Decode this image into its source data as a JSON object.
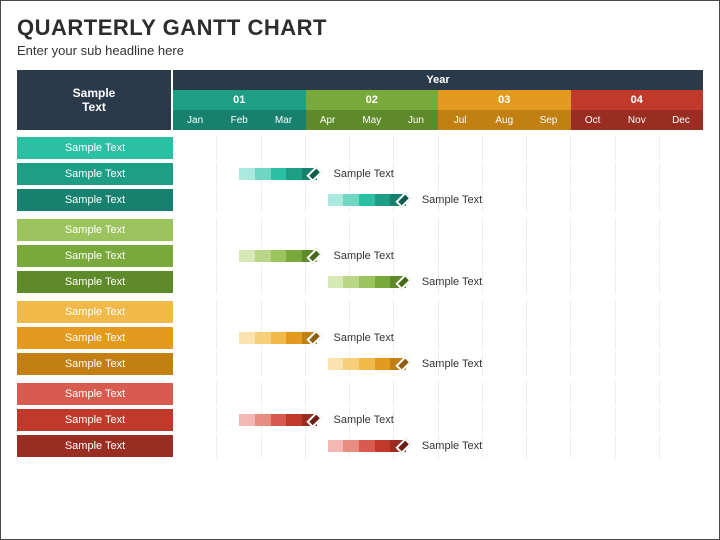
{
  "title": "QUARTERLY GANTT CHART",
  "subtitle": "Enter your sub headline here",
  "corner": "Sample\nText",
  "header": {
    "year_label": "Year",
    "quarters": [
      {
        "label": "01",
        "color": "#1f9e86",
        "months_bg": "#17816d"
      },
      {
        "label": "02",
        "color": "#7aa93b",
        "months_bg": "#5f8a2a"
      },
      {
        "label": "03",
        "color": "#e39a1f",
        "months_bg": "#c27f12"
      },
      {
        "label": "04",
        "color": "#c0392b",
        "months_bg": "#992d22"
      }
    ],
    "months": [
      "Jan",
      "Feb",
      "Mar",
      "Apr",
      "May",
      "Jun",
      "Jul",
      "Aug",
      "Sep",
      "Oct",
      "Nov",
      "Dec"
    ]
  },
  "chart_data": {
    "type": "gantt",
    "title": "Quarterly Gantt Chart",
    "x_categories_months": [
      "Jan",
      "Feb",
      "Mar",
      "Apr",
      "May",
      "Jun",
      "Jul",
      "Aug",
      "Sep",
      "Oct",
      "Nov",
      "Dec"
    ],
    "groups": [
      {
        "color_family": "teal",
        "label_colors": [
          "#2bbfa3",
          "#1f9e86",
          "#17816d"
        ],
        "row_labels": [
          "Sample Text",
          "Sample Text",
          "Sample Text"
        ],
        "bars": [
          {
            "start_month": 1.5,
            "end_month": 5.0,
            "annotation": "Sample Text",
            "segments": [
              "#a9e9de",
              "#6fd6c4",
              "#2bbfa3",
              "#1f9e86",
              "#17816d"
            ],
            "diamond": "#0e5a4c"
          },
          {
            "start_month": 3.5,
            "end_month": 7.0,
            "annotation": "Sample Text",
            "segments": [
              "#a9e9de",
              "#6fd6c4",
              "#2bbfa3",
              "#1f9e86",
              "#17816d"
            ],
            "diamond": "#0e5a4c"
          }
        ]
      },
      {
        "color_family": "green",
        "label_colors": [
          "#9bc45f",
          "#7aa93b",
          "#5f8a2a"
        ],
        "row_labels": [
          "Sample Text",
          "Sample Text",
          "Sample Text"
        ],
        "bars": [
          {
            "start_month": 1.5,
            "end_month": 5.0,
            "annotation": "Sample Text",
            "segments": [
              "#d6e8b5",
              "#b9d786",
              "#9bc45f",
              "#7aa93b",
              "#5f8a2a"
            ],
            "diamond": "#476b1d"
          },
          {
            "start_month": 3.5,
            "end_month": 7.0,
            "annotation": "Sample Text",
            "segments": [
              "#d6e8b5",
              "#b9d786",
              "#9bc45f",
              "#7aa93b",
              "#5f8a2a"
            ],
            "diamond": "#476b1d"
          }
        ]
      },
      {
        "color_family": "orange",
        "label_colors": [
          "#f1b94a",
          "#e39a1f",
          "#c27f12"
        ],
        "row_labels": [
          "Sample Text",
          "Sample Text",
          "Sample Text"
        ],
        "bars": [
          {
            "start_month": 1.5,
            "end_month": 5.0,
            "annotation": "Sample Text",
            "segments": [
              "#fbe3b0",
              "#f6cf7a",
              "#f1b94a",
              "#e39a1f",
              "#c27f12"
            ],
            "diamond": "#8f5d0b"
          },
          {
            "start_month": 3.5,
            "end_month": 7.0,
            "annotation": "Sample Text",
            "segments": [
              "#fbe3b0",
              "#f6cf7a",
              "#f1b94a",
              "#e39a1f",
              "#c27f12"
            ],
            "diamond": "#8f5d0b"
          }
        ]
      },
      {
        "color_family": "red",
        "label_colors": [
          "#d75b4e",
          "#c0392b",
          "#992d22"
        ],
        "row_labels": [
          "Sample Text",
          "Sample Text",
          "Sample Text"
        ],
        "bars": [
          {
            "start_month": 1.5,
            "end_month": 5.0,
            "annotation": "Sample Text",
            "segments": [
              "#f2b8b1",
              "#e88d82",
              "#d75b4e",
              "#c0392b",
              "#992d22"
            ],
            "diamond": "#6d1f17"
          },
          {
            "start_month": 3.5,
            "end_month": 7.0,
            "annotation": "Sample Text",
            "segments": [
              "#f2b8b1",
              "#e88d82",
              "#d75b4e",
              "#c0392b",
              "#992d22"
            ],
            "diamond": "#6d1f17"
          }
        ]
      }
    ]
  }
}
